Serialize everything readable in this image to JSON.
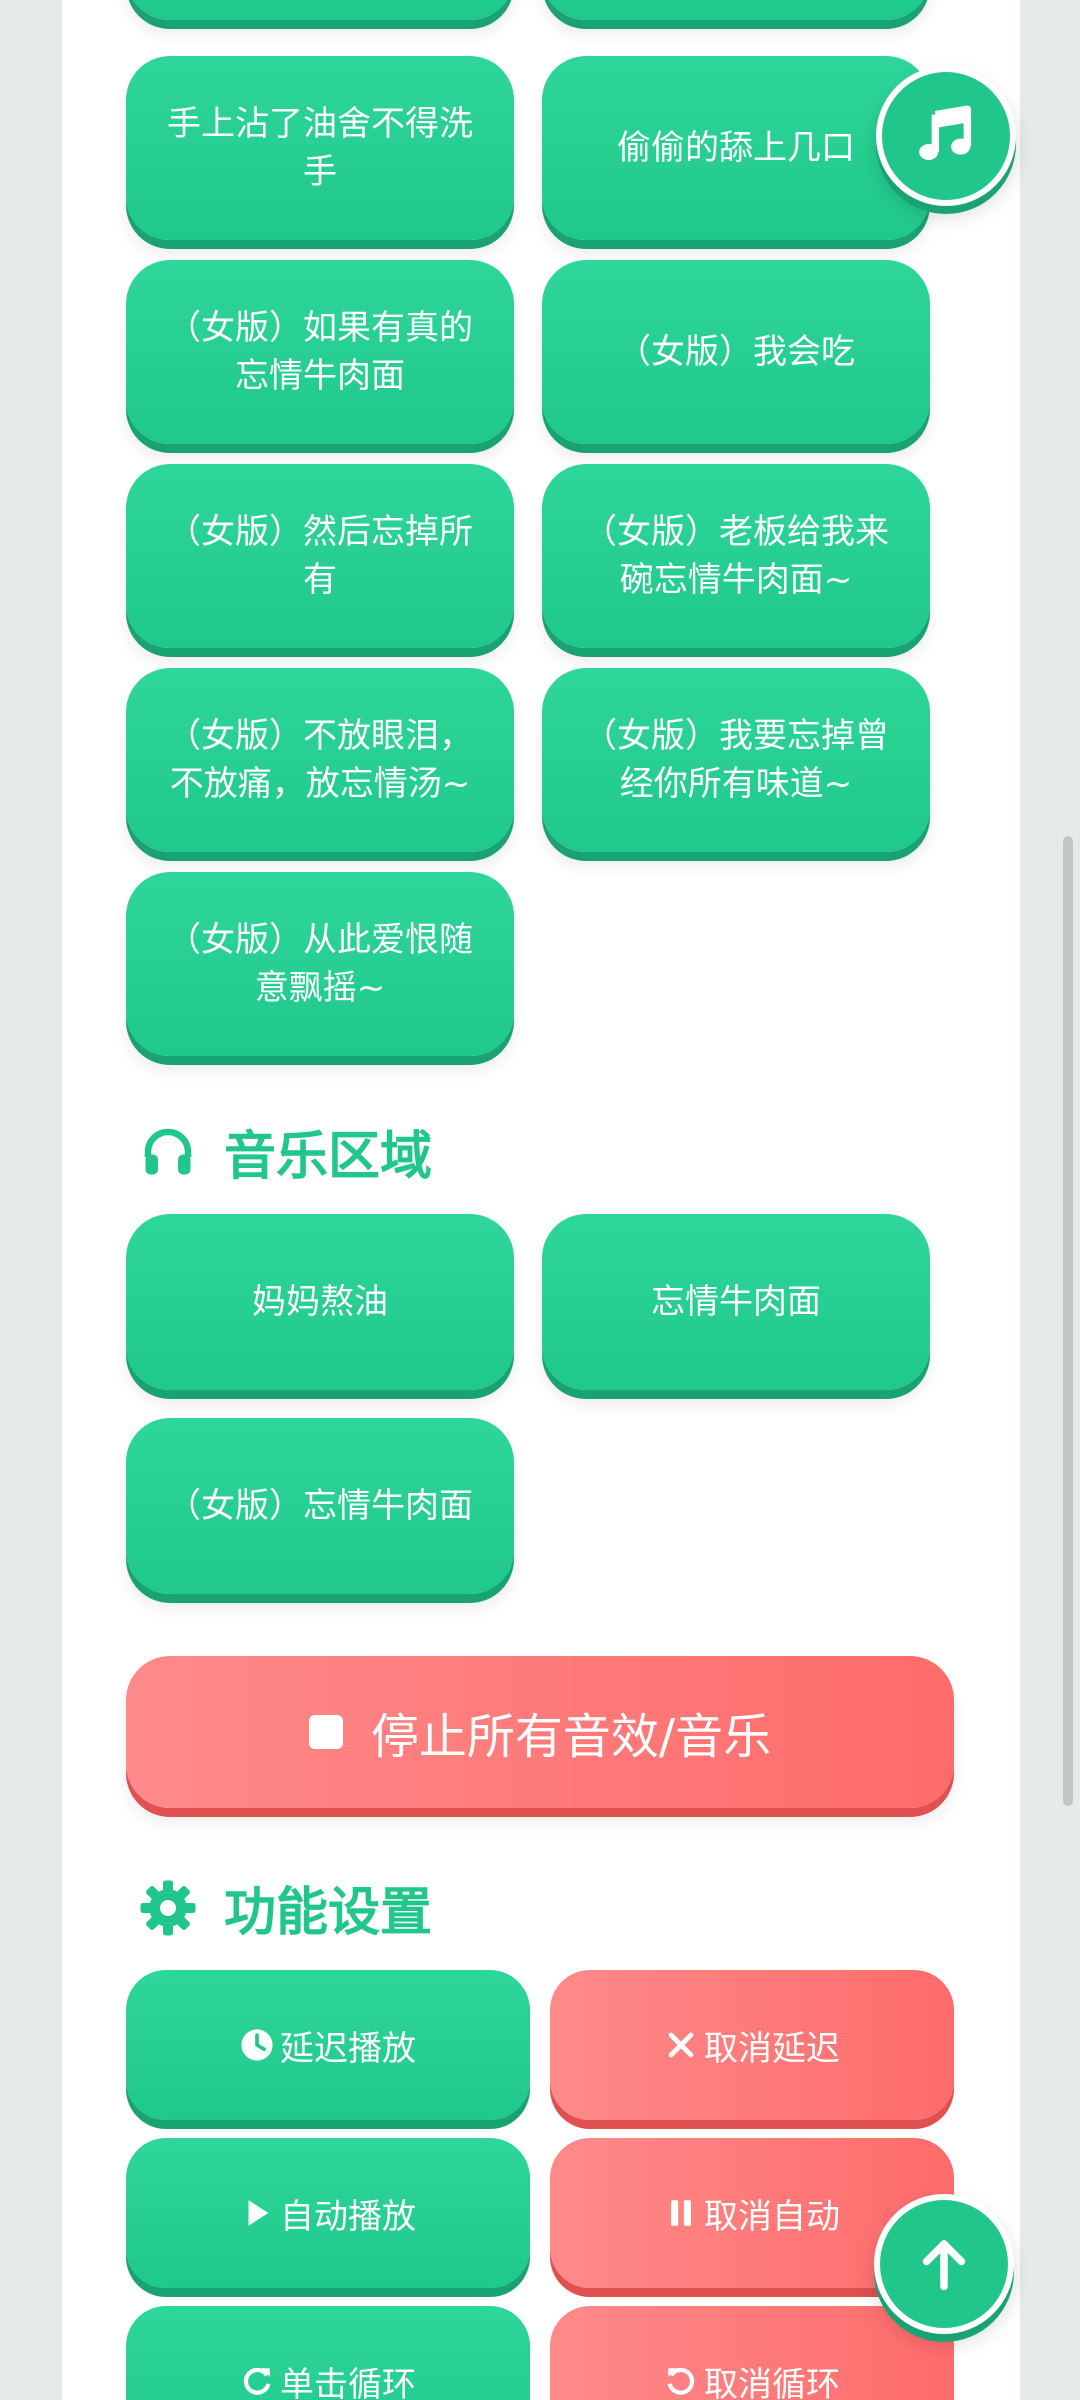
{
  "sound_buttons": [
    {
      "label": ""
    },
    {
      "label": ""
    },
    {
      "label": "手上沾了油舍不得洗手"
    },
    {
      "label": "偷偷的舔上几口"
    },
    {
      "label": "（女版）如果有真的忘情牛肉面"
    },
    {
      "label": "（女版）我会吃"
    },
    {
      "label": "（女版）然后忘掉所有"
    },
    {
      "label": "（女版）老板给我来碗忘情牛肉面~"
    },
    {
      "label": "（女版）不放眼泪，不放痛，放忘情汤~"
    },
    {
      "label": "（女版）我要忘掉曾经你所有味道~"
    },
    {
      "label": "（女版）从此爱恨随意飘摇~"
    }
  ],
  "music_section": {
    "title": "音乐区域",
    "icon": "headphones-icon",
    "items": [
      {
        "label": "妈妈熬油"
      },
      {
        "label": "忘情牛肉面"
      },
      {
        "label": "（女版）忘情牛肉面"
      }
    ]
  },
  "stop_button": {
    "label": "停止所有音效/音乐",
    "icon": "stop-icon"
  },
  "settings_section": {
    "title": "功能设置",
    "icon": "gear-icon",
    "buttons": [
      {
        "label": "延迟播放",
        "icon": "clock-icon"
      },
      {
        "label": "取消延迟",
        "icon": "close-icon"
      },
      {
        "label": "自动播放",
        "icon": "play-icon"
      },
      {
        "label": "取消自动",
        "icon": "pause-icon"
      },
      {
        "label": "单击循环",
        "icon": "redo-icon"
      },
      {
        "label": "取消循环",
        "icon": "undo-icon"
      }
    ]
  },
  "fabs": {
    "music": "music-note-icon",
    "top": "arrow-up-icon"
  },
  "colors": {
    "green": "#21c68a",
    "green_dark": "#1aa372",
    "red": "#ff6b6b",
    "red_dark": "#e05050"
  }
}
